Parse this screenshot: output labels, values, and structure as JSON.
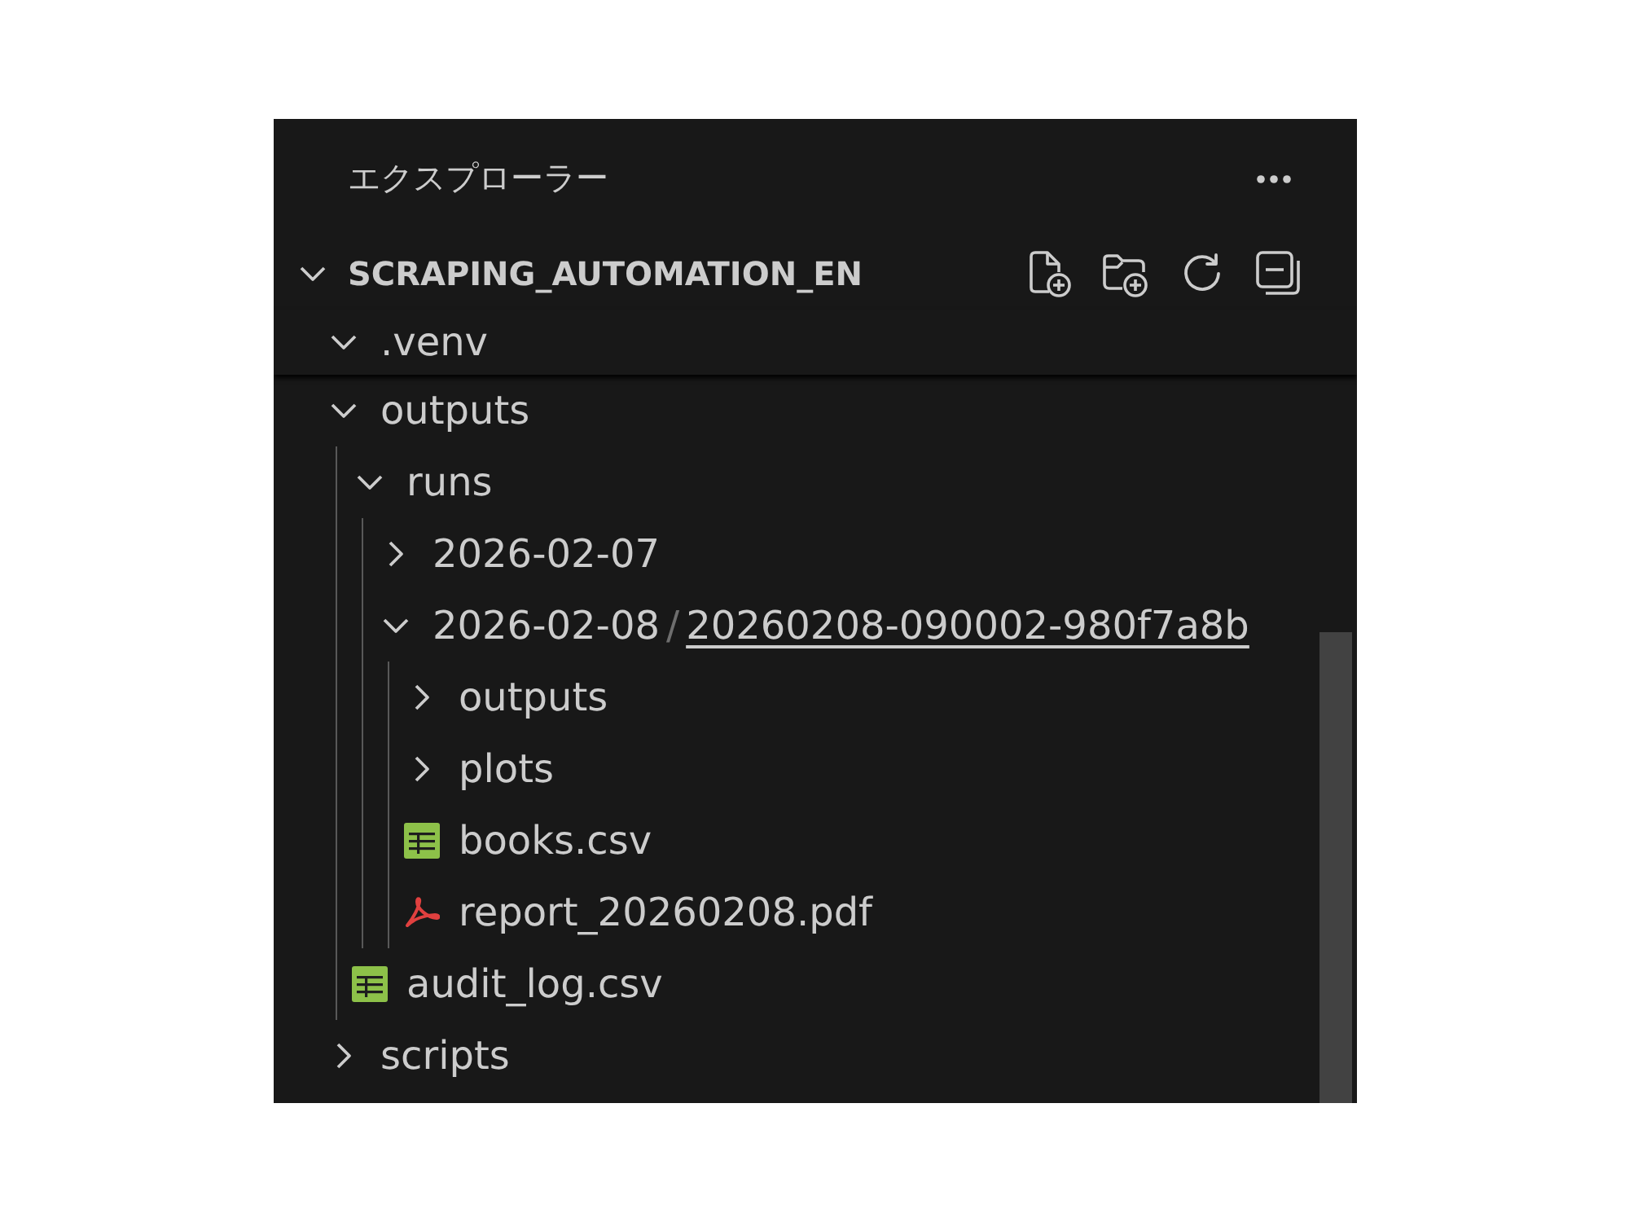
{
  "explorer": {
    "title": "エクスプローラー"
  },
  "root": {
    "name": "SCRAPING_AUTOMATION_EN",
    "expanded": true
  },
  "sticky": [
    {
      "kind": "folder",
      "name": ".venv",
      "expanded": true
    }
  ],
  "tree": [
    {
      "kind": "folder",
      "name": "outputs",
      "expanded": true,
      "children": [
        {
          "kind": "folder",
          "name": "runs",
          "expanded": true,
          "children": [
            {
              "kind": "folder",
              "name": "2026-02-07",
              "expanded": false
            },
            {
              "kind": "compact_folder",
              "segments": [
                {
                  "label": "2026-02-08",
                  "hovered": false
                },
                {
                  "label": "20260208-090002-980f7a8b",
                  "hovered": true
                }
              ],
              "separator": "/",
              "expanded": true,
              "children": [
                {
                  "kind": "folder",
                  "name": "outputs",
                  "expanded": false
                },
                {
                  "kind": "folder",
                  "name": "plots",
                  "expanded": false
                },
                {
                  "kind": "csv",
                  "name": "books.csv"
                },
                {
                  "kind": "pdf",
                  "name": "report_20260208.pdf"
                }
              ]
            }
          ]
        },
        {
          "kind": "csv",
          "name": "audit_log.csv"
        }
      ]
    },
    {
      "kind": "folder",
      "name": "scripts",
      "expanded": false
    }
  ]
}
